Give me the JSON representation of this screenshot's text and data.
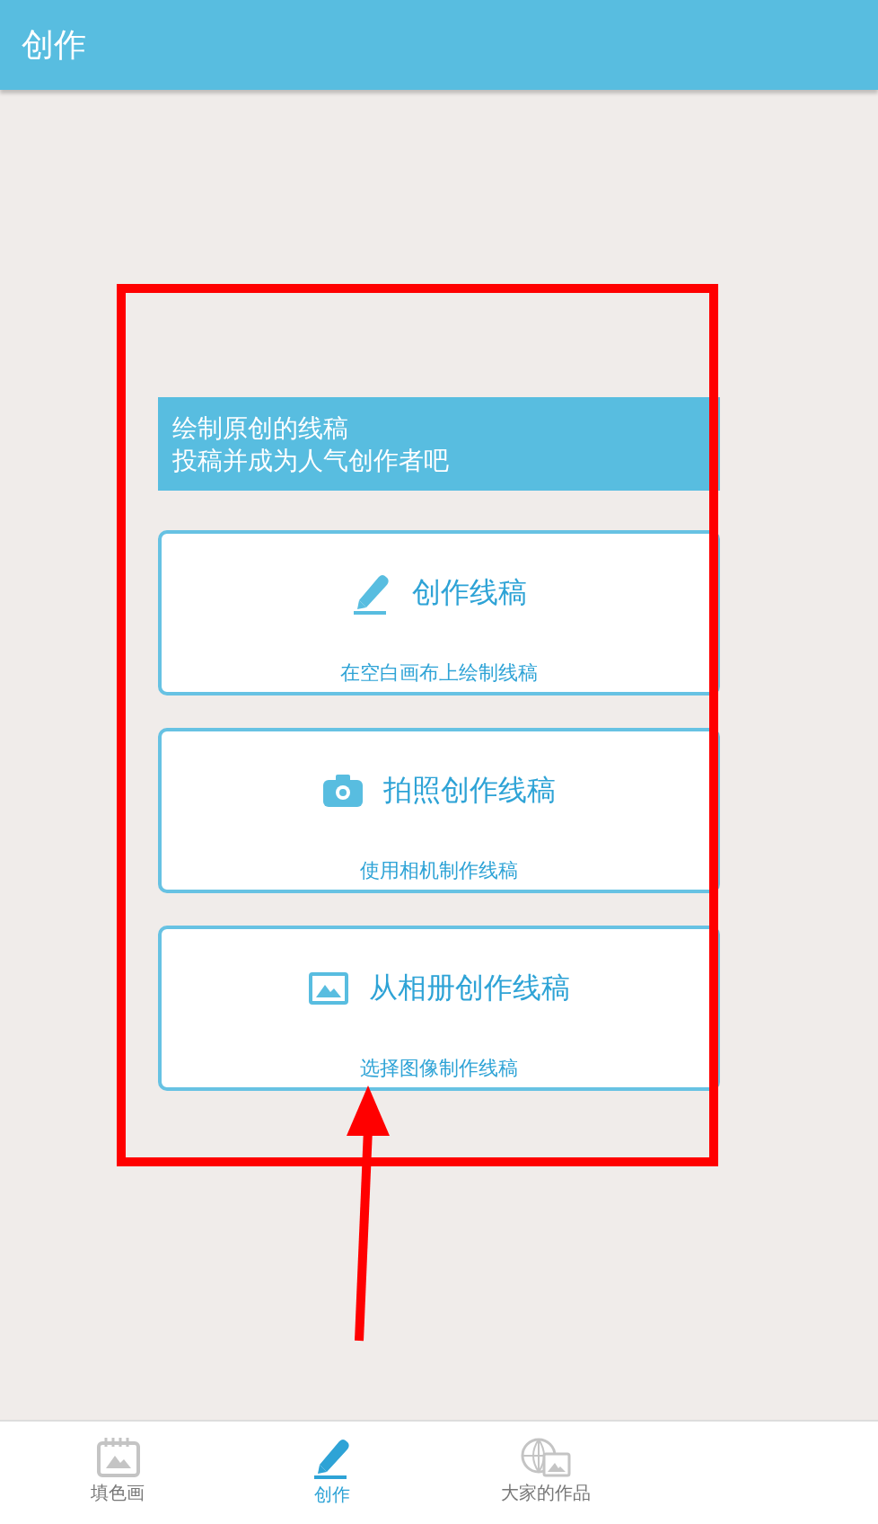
{
  "header": {
    "title": "创作"
  },
  "banner": {
    "lines": [
      "绘制原创的线稿",
      "投稿并成为人气创作者吧"
    ]
  },
  "options": [
    {
      "kind": "pencil",
      "title": "创作线稿",
      "subtitle": "在空白画布上绘制线稿"
    },
    {
      "kind": "camera",
      "title": "拍照创作线稿",
      "subtitle": "使用相机制作线稿"
    },
    {
      "kind": "image",
      "title": "从相册创作线稿",
      "subtitle": "选择图像制作线稿"
    }
  ],
  "bottom_nav": [
    {
      "kind": "calendar",
      "label": "填色画",
      "selected": false
    },
    {
      "kind": "pencil",
      "label": "创作",
      "selected": true
    },
    {
      "kind": "globe",
      "label": "大家的作品",
      "selected": false
    }
  ]
}
